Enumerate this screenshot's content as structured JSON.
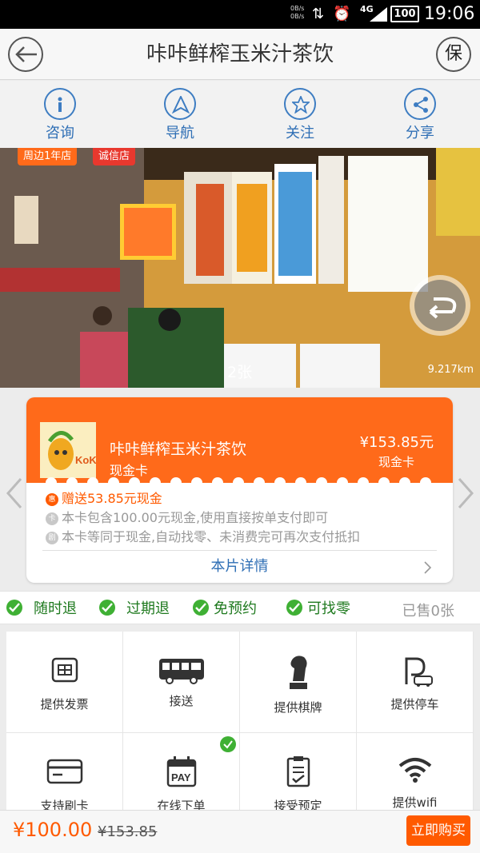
{
  "status_bar": {
    "net_up": "0B/s",
    "net_down": "0B/s",
    "network": "4G",
    "battery": "100",
    "time": "19:06"
  },
  "header": {
    "title": "咔咔鲜榨玉米汁茶饮",
    "right_button": "保"
  },
  "actions": [
    {
      "label": "咨询",
      "icon": "info-icon"
    },
    {
      "label": "导航",
      "icon": "navigation-icon"
    },
    {
      "label": "关注",
      "icon": "star-icon"
    },
    {
      "label": "分享",
      "icon": "share-icon"
    }
  ],
  "hero": {
    "tags": [
      "周边1年店",
      "诚信店"
    ],
    "photo_count": "2张",
    "distance": "9.217km"
  },
  "card": {
    "name": "咔咔鲜榨玉米汁茶饮",
    "type": "现金卡",
    "price": "¥153.85元",
    "price_type": "现金卡",
    "features": [
      {
        "badge": "惠",
        "text": "赠送53.85元现金",
        "color": "#ff5a00"
      },
      {
        "badge": "卡",
        "text": "本卡包含100.00元现金,使用直接按单支付即可",
        "color": "#999999"
      },
      {
        "badge": "剧",
        "text": "本卡等同于现金,自动找零、未消费完可再次支付抵扣",
        "color": "#999999"
      }
    ],
    "detail_link": "本片详情"
  },
  "guarantees": [
    "随时退",
    "过期退",
    "免预约",
    "可找零"
  ],
  "sold": "已售0张",
  "services": [
    {
      "label": "提供发票",
      "icon": "invoice-icon",
      "checked": false
    },
    {
      "label": "接送",
      "icon": "bus-icon",
      "checked": false
    },
    {
      "label": "提供棋牌",
      "icon": "chess-icon",
      "checked": false
    },
    {
      "label": "提供停车",
      "icon": "parking-icon",
      "checked": false
    },
    {
      "label": "支持刷卡",
      "icon": "credit-card-icon",
      "checked": false
    },
    {
      "label": "在线下单",
      "icon": "pay-calendar-icon",
      "checked": true
    },
    {
      "label": "接受预定",
      "icon": "clipboard-icon",
      "checked": false
    },
    {
      "label": "提供wifi",
      "icon": "wifi-icon",
      "checked": false
    }
  ],
  "bottom": {
    "price": "¥100.00",
    "original_price": "¥153.85",
    "buy_label": "立即购买"
  },
  "colors": {
    "accent": "#ff6a1a",
    "link": "#2f6fb5",
    "check": "#3fb034"
  }
}
